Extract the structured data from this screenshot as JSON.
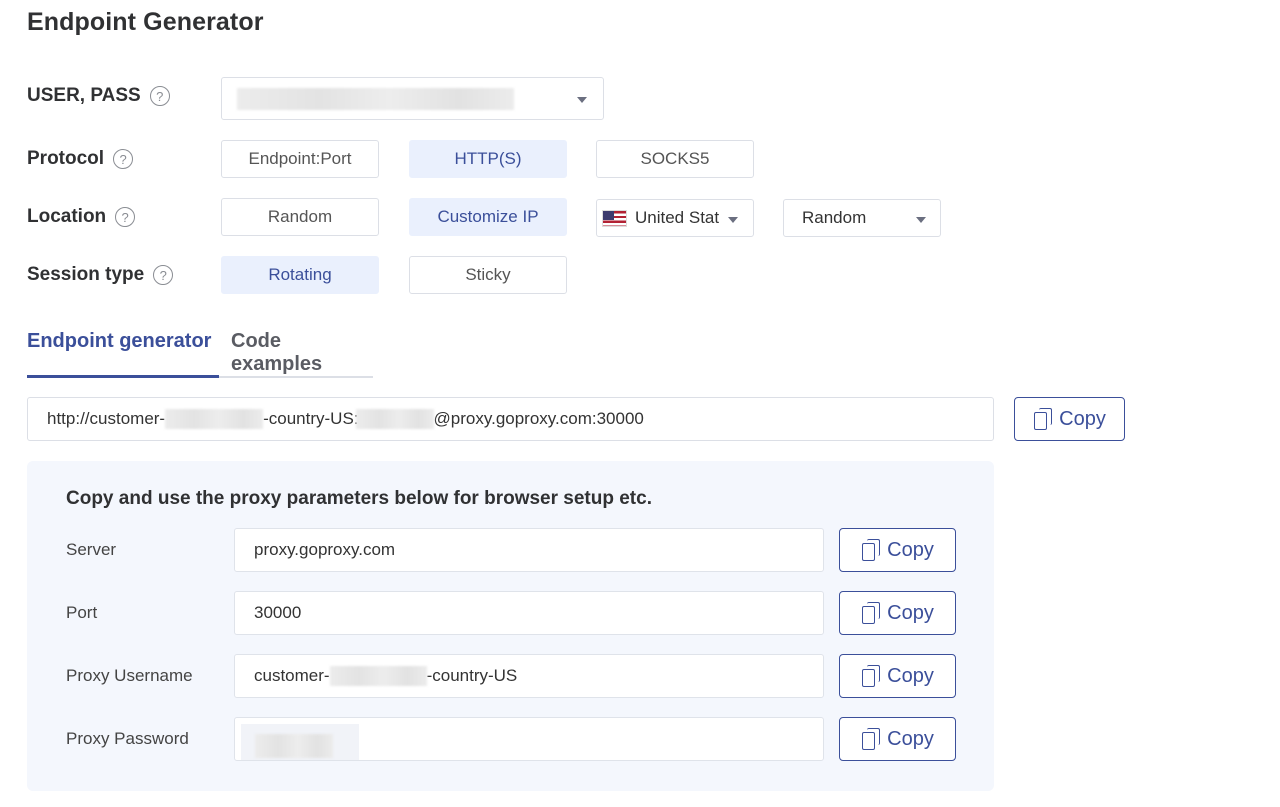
{
  "title": "Endpoint Generator",
  "user_pass": {
    "label": "USER, PASS",
    "selected_value": ""
  },
  "protocol": {
    "label": "Protocol",
    "options": [
      "Endpoint:Port",
      "HTTP(S)",
      "SOCKS5"
    ],
    "selected": "HTTP(S)"
  },
  "location": {
    "label": "Location",
    "options": [
      "Random",
      "Customize IP"
    ],
    "selected": "Customize IP",
    "country_select": {
      "value": "United Stat",
      "flag_icon": "us-flag-icon"
    },
    "region_select": {
      "value": "Random"
    }
  },
  "session_type": {
    "label": "Session type",
    "options": [
      "Rotating",
      "Sticky"
    ],
    "selected": "Rotating"
  },
  "tabs": [
    {
      "label": "Endpoint generator",
      "active": true
    },
    {
      "label": "Code examples",
      "active": false
    }
  ],
  "endpoint": {
    "prefix": "http://customer-",
    "middle": "-country-US:",
    "suffix": "@proxy.goproxy.com:30000",
    "copy_label": "Copy"
  },
  "params": {
    "heading": "Copy and use the proxy parameters below for browser setup etc.",
    "rows": [
      {
        "label": "Server",
        "value": "proxy.goproxy.com",
        "copy_label": "Copy"
      },
      {
        "label": "Port",
        "value": "30000",
        "copy_label": "Copy"
      },
      {
        "label": "Proxy Username",
        "value_prefix": "customer-",
        "value_suffix": "-country-US",
        "copy_label": "Copy"
      },
      {
        "label": "Proxy Password",
        "value": "",
        "copy_label": "Copy"
      }
    ]
  },
  "colors": {
    "accent": "#3b4f9a",
    "active_bg": "#eaf0fd",
    "panel_bg": "#f4f7fd",
    "border": "#dcdfe6"
  }
}
